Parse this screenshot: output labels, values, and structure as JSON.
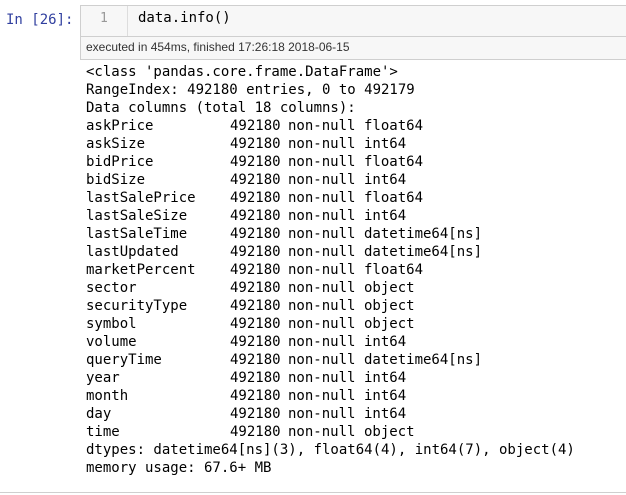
{
  "prompt": "In [26]:",
  "input": {
    "line_number": "1",
    "code": "data.info()"
  },
  "execution_info": "executed in 454ms, finished 17:26:18 2018-06-15",
  "output": {
    "class_line": "<class 'pandas.core.frame.DataFrame'>",
    "range_index": "RangeIndex: 492180 entries, 0 to 492179",
    "columns_header": "Data columns (total 18 columns):",
    "columns": [
      {
        "name": "askPrice",
        "count": "492180",
        "nonnull": "non-null",
        "dtype": "float64"
      },
      {
        "name": "askSize",
        "count": "492180",
        "nonnull": "non-null",
        "dtype": "int64"
      },
      {
        "name": "bidPrice",
        "count": "492180",
        "nonnull": "non-null",
        "dtype": "float64"
      },
      {
        "name": "bidSize",
        "count": "492180",
        "nonnull": "non-null",
        "dtype": "int64"
      },
      {
        "name": "lastSalePrice",
        "count": "492180",
        "nonnull": "non-null",
        "dtype": "float64"
      },
      {
        "name": "lastSaleSize",
        "count": "492180",
        "nonnull": "non-null",
        "dtype": "int64"
      },
      {
        "name": "lastSaleTime",
        "count": "492180",
        "nonnull": "non-null",
        "dtype": "datetime64[ns]"
      },
      {
        "name": "lastUpdated",
        "count": "492180",
        "nonnull": "non-null",
        "dtype": "datetime64[ns]"
      },
      {
        "name": "marketPercent",
        "count": "492180",
        "nonnull": "non-null",
        "dtype": "float64"
      },
      {
        "name": "sector",
        "count": "492180",
        "nonnull": "non-null",
        "dtype": "object"
      },
      {
        "name": "securityType",
        "count": "492180",
        "nonnull": "non-null",
        "dtype": "object"
      },
      {
        "name": "symbol",
        "count": "492180",
        "nonnull": "non-null",
        "dtype": "object"
      },
      {
        "name": "volume",
        "count": "492180",
        "nonnull": "non-null",
        "dtype": "int64"
      },
      {
        "name": "queryTime",
        "count": "492180",
        "nonnull": "non-null",
        "dtype": "datetime64[ns]"
      },
      {
        "name": "year",
        "count": "492180",
        "nonnull": "non-null",
        "dtype": "int64"
      },
      {
        "name": "month",
        "count": "492180",
        "nonnull": "non-null",
        "dtype": "int64"
      },
      {
        "name": "day",
        "count": "492180",
        "nonnull": "non-null",
        "dtype": "int64"
      },
      {
        "name": "time",
        "count": "492180",
        "nonnull": "non-null",
        "dtype": "object"
      }
    ],
    "dtypes_line": "dtypes: datetime64[ns](3), float64(4), int64(7), object(4)",
    "memory_line": "memory usage: 67.6+ MB"
  },
  "colors": {
    "prompt": "#303f9f",
    "input_background": "#f7f7f7",
    "border": "#cfcfcf"
  }
}
